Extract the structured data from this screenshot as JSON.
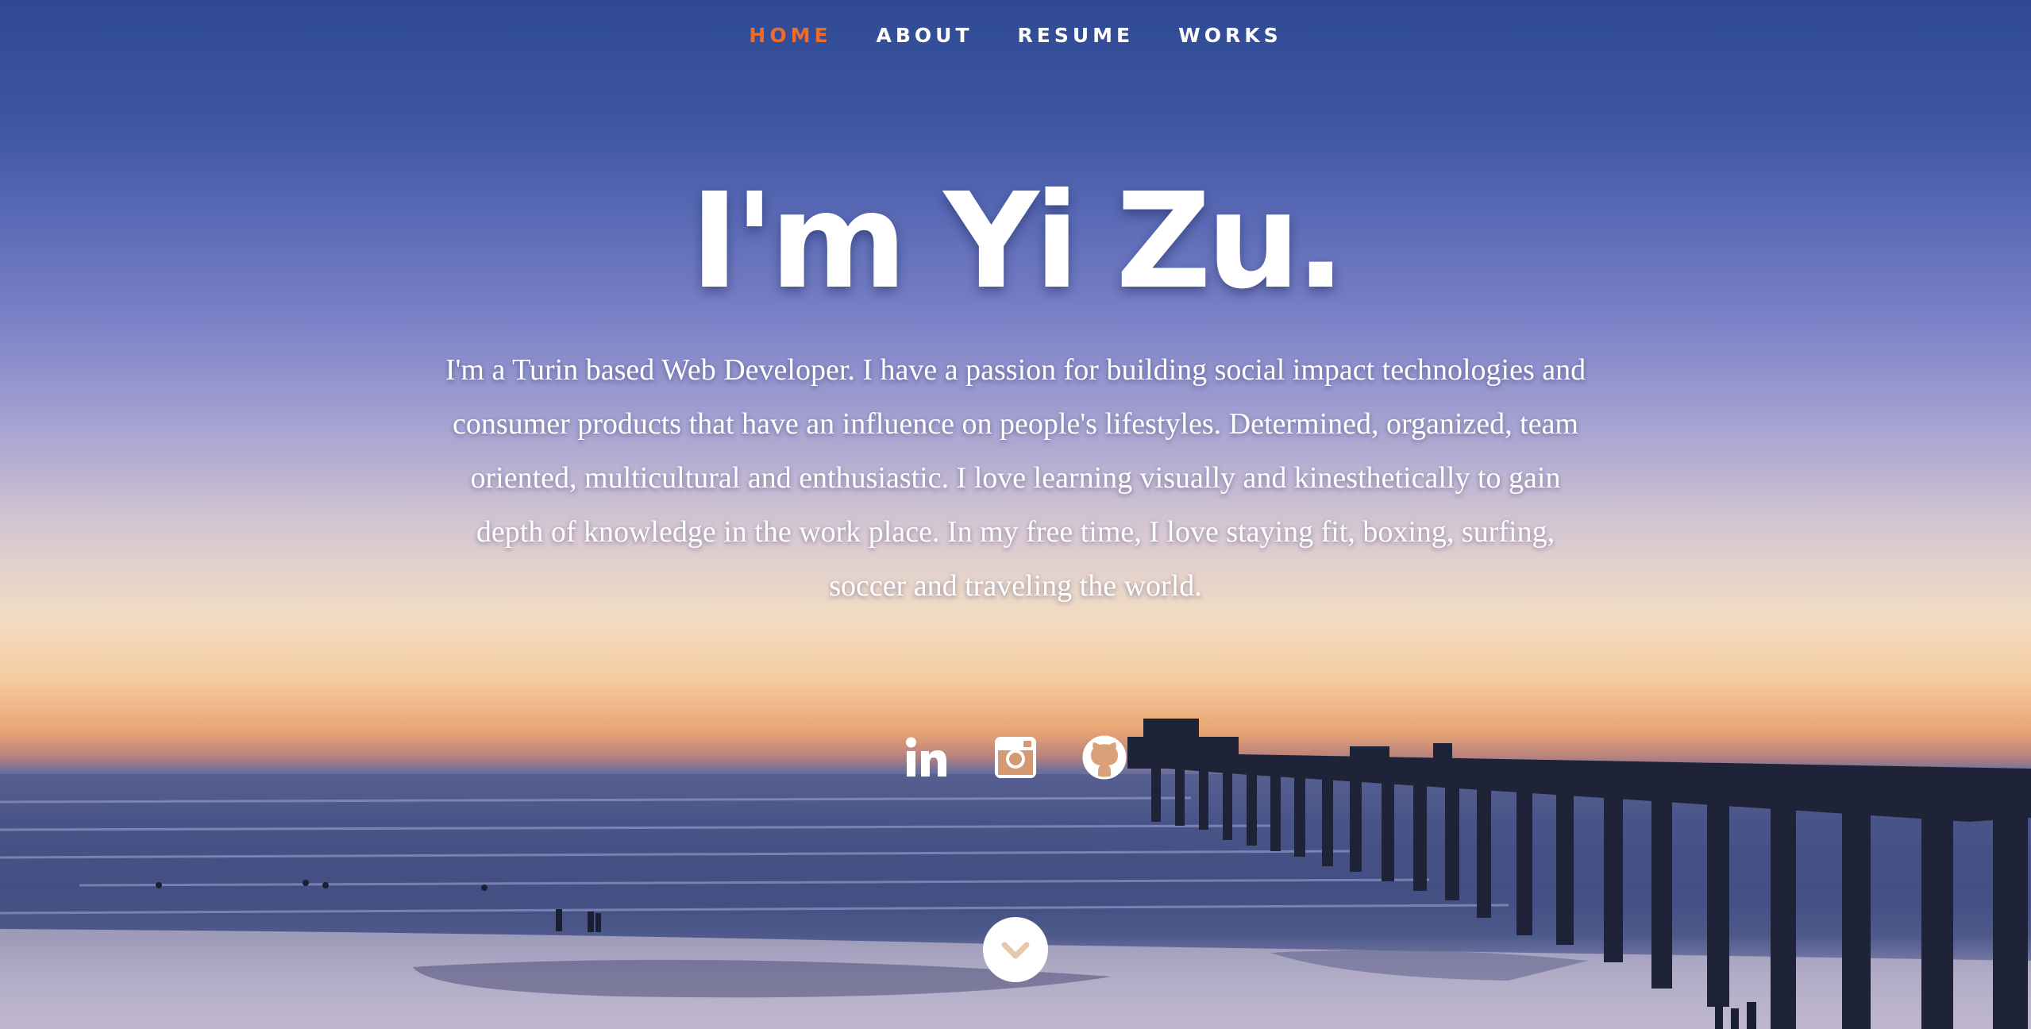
{
  "nav": {
    "items": [
      {
        "label": "HOME",
        "active": true
      },
      {
        "label": "ABOUT",
        "active": false
      },
      {
        "label": "RESUME",
        "active": false
      },
      {
        "label": "WORKS",
        "active": false
      }
    ],
    "active_color": "#ec6d2b"
  },
  "hero": {
    "title": "I'm Yi Zu.",
    "bio": "I'm a Turin based Web Developer. I have a passion for building social impact technologies and consumer products that have an influence on people's lifestyles. Determined, organized, team oriented, multicultural and enthusiastic. I love learning visually and kinesthetically to gain depth of knowledge in the work place. In my free time, I love staying fit, boxing, surfing, soccer and traveling the world."
  },
  "social": {
    "icons": [
      "linkedin-icon",
      "instagram-icon",
      "github-icon"
    ]
  },
  "scroll": {
    "icon": "chevron-down-icon"
  }
}
